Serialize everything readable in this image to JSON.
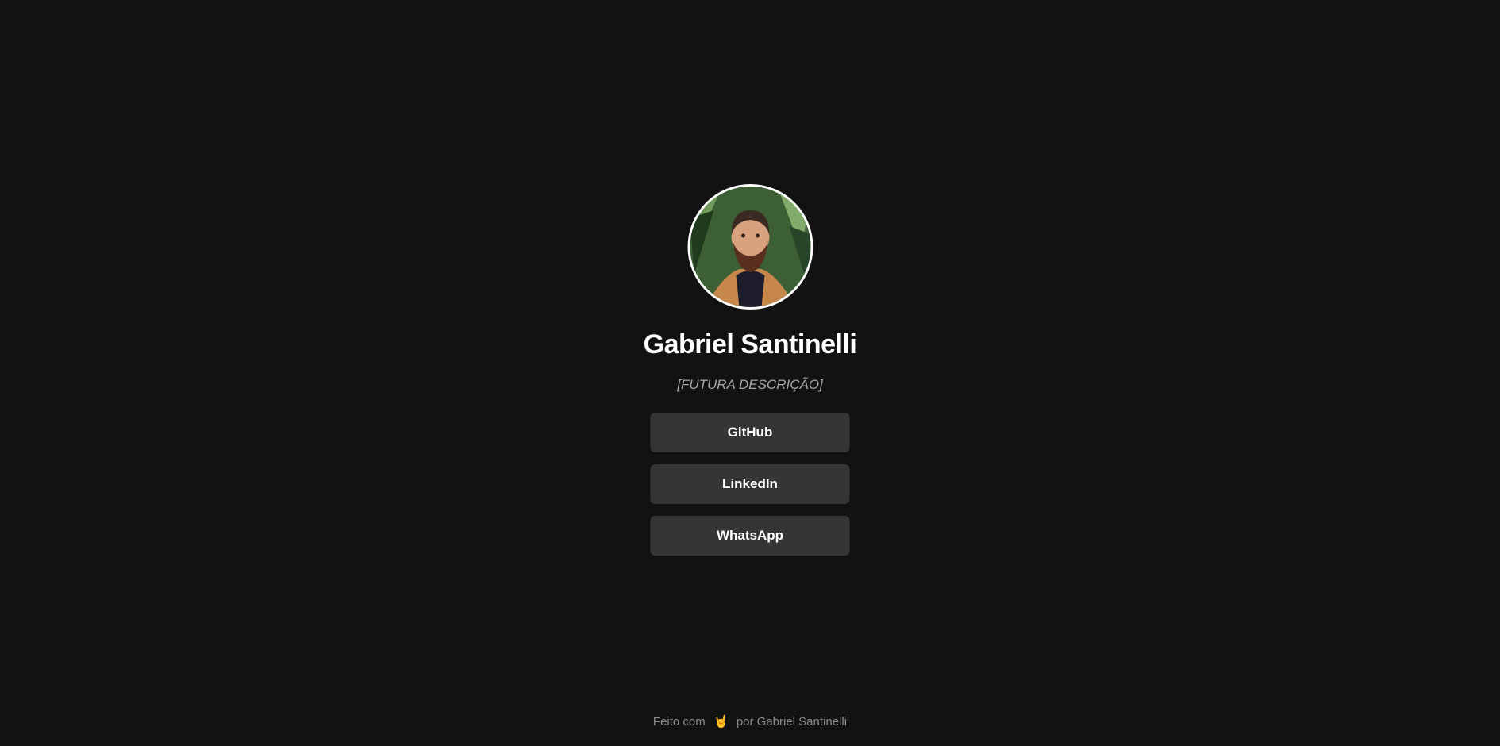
{
  "profile": {
    "name": "Gabriel Santinelli",
    "description": "[FUTURA DESCRIÇÃO]"
  },
  "links": [
    {
      "label": "GitHub"
    },
    {
      "label": "LinkedIn"
    },
    {
      "label": "WhatsApp"
    }
  ],
  "footer": {
    "prefix": "Feito com",
    "emoji": "🤘",
    "suffix": "por Gabriel Santinelli"
  },
  "colors": {
    "background": "#121212",
    "button": "#353535",
    "text": "#ffffff",
    "muted": "#a6a6a6"
  }
}
